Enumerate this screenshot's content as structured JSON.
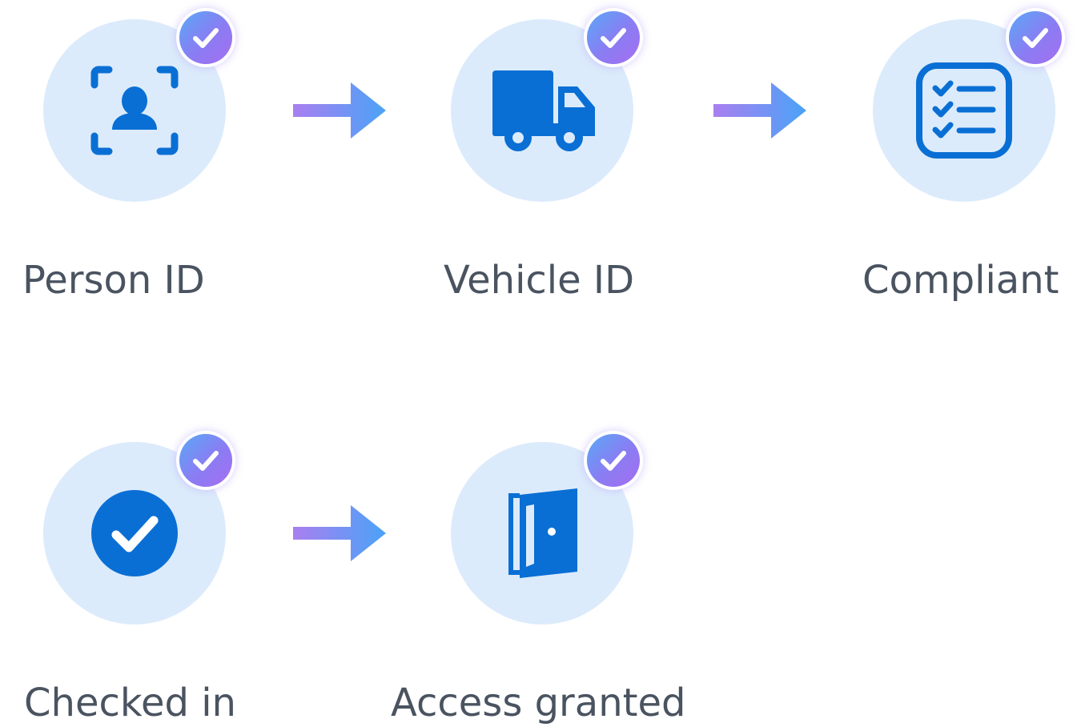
{
  "steps": [
    {
      "label": "Person ID",
      "icon": "person-scan-icon",
      "completed": true
    },
    {
      "label": "Vehicle ID",
      "icon": "truck-icon",
      "completed": true
    },
    {
      "label": "Compliant",
      "icon": "checklist-icon",
      "completed": true
    },
    {
      "label": "Checked in",
      "icon": "check-circle-icon",
      "completed": true
    },
    {
      "label": "Access granted",
      "icon": "open-door-icon",
      "completed": true
    }
  ],
  "colors": {
    "icon": "#0a6fd4",
    "circle_bg": "#dcebfb",
    "badge_gradient_start": "#5aa8f6",
    "badge_gradient_end": "#a56ef0",
    "arrow_gradient_start": "#a97ff0",
    "arrow_gradient_end": "#4aa3f7",
    "label": "#4a5360"
  }
}
